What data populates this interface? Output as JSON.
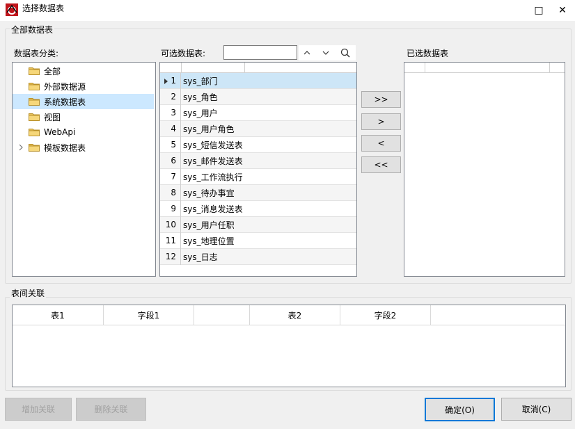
{
  "window": {
    "title": "选择数据表",
    "minimize": "□",
    "close": "✕"
  },
  "all_tables_group": {
    "title": "全部数据表"
  },
  "category": {
    "label": "数据表分类:",
    "items": [
      {
        "label": "全部"
      },
      {
        "label": "外部数据源"
      },
      {
        "label": "系统数据表",
        "selected": true
      },
      {
        "label": "视图"
      },
      {
        "label": "WebApi"
      },
      {
        "label": "模板数据表",
        "expandable": true
      }
    ]
  },
  "available": {
    "label": "可选数据表:",
    "search_value": "",
    "rows": [
      {
        "n": "1",
        "name": "sys_部门"
      },
      {
        "n": "2",
        "name": "sys_角色"
      },
      {
        "n": "3",
        "name": "sys_用户"
      },
      {
        "n": "4",
        "name": "sys_用户角色"
      },
      {
        "n": "5",
        "name": "sys_短信发送表"
      },
      {
        "n": "6",
        "name": "sys_邮件发送表"
      },
      {
        "n": "7",
        "name": "sys_工作流执行"
      },
      {
        "n": "8",
        "name": "sys_待办事宜"
      },
      {
        "n": "9",
        "name": "sys_消息发送表"
      },
      {
        "n": "10",
        "name": "sys_用户任职"
      },
      {
        "n": "11",
        "name": "sys_地理位置"
      },
      {
        "n": "12",
        "name": "sys_日志"
      }
    ]
  },
  "transfer": {
    "add_all": ">>",
    "add": ">",
    "remove": "<",
    "remove_all": "<<"
  },
  "selected": {
    "label": "已选数据表"
  },
  "relations": {
    "title": "表间关联",
    "columns": [
      "表1",
      "字段1",
      "",
      "表2",
      "字段2",
      ""
    ]
  },
  "footer": {
    "add_relation": "增加关联",
    "delete_relation": "删除关联",
    "ok": "确定(O)",
    "cancel": "取消(C)"
  }
}
